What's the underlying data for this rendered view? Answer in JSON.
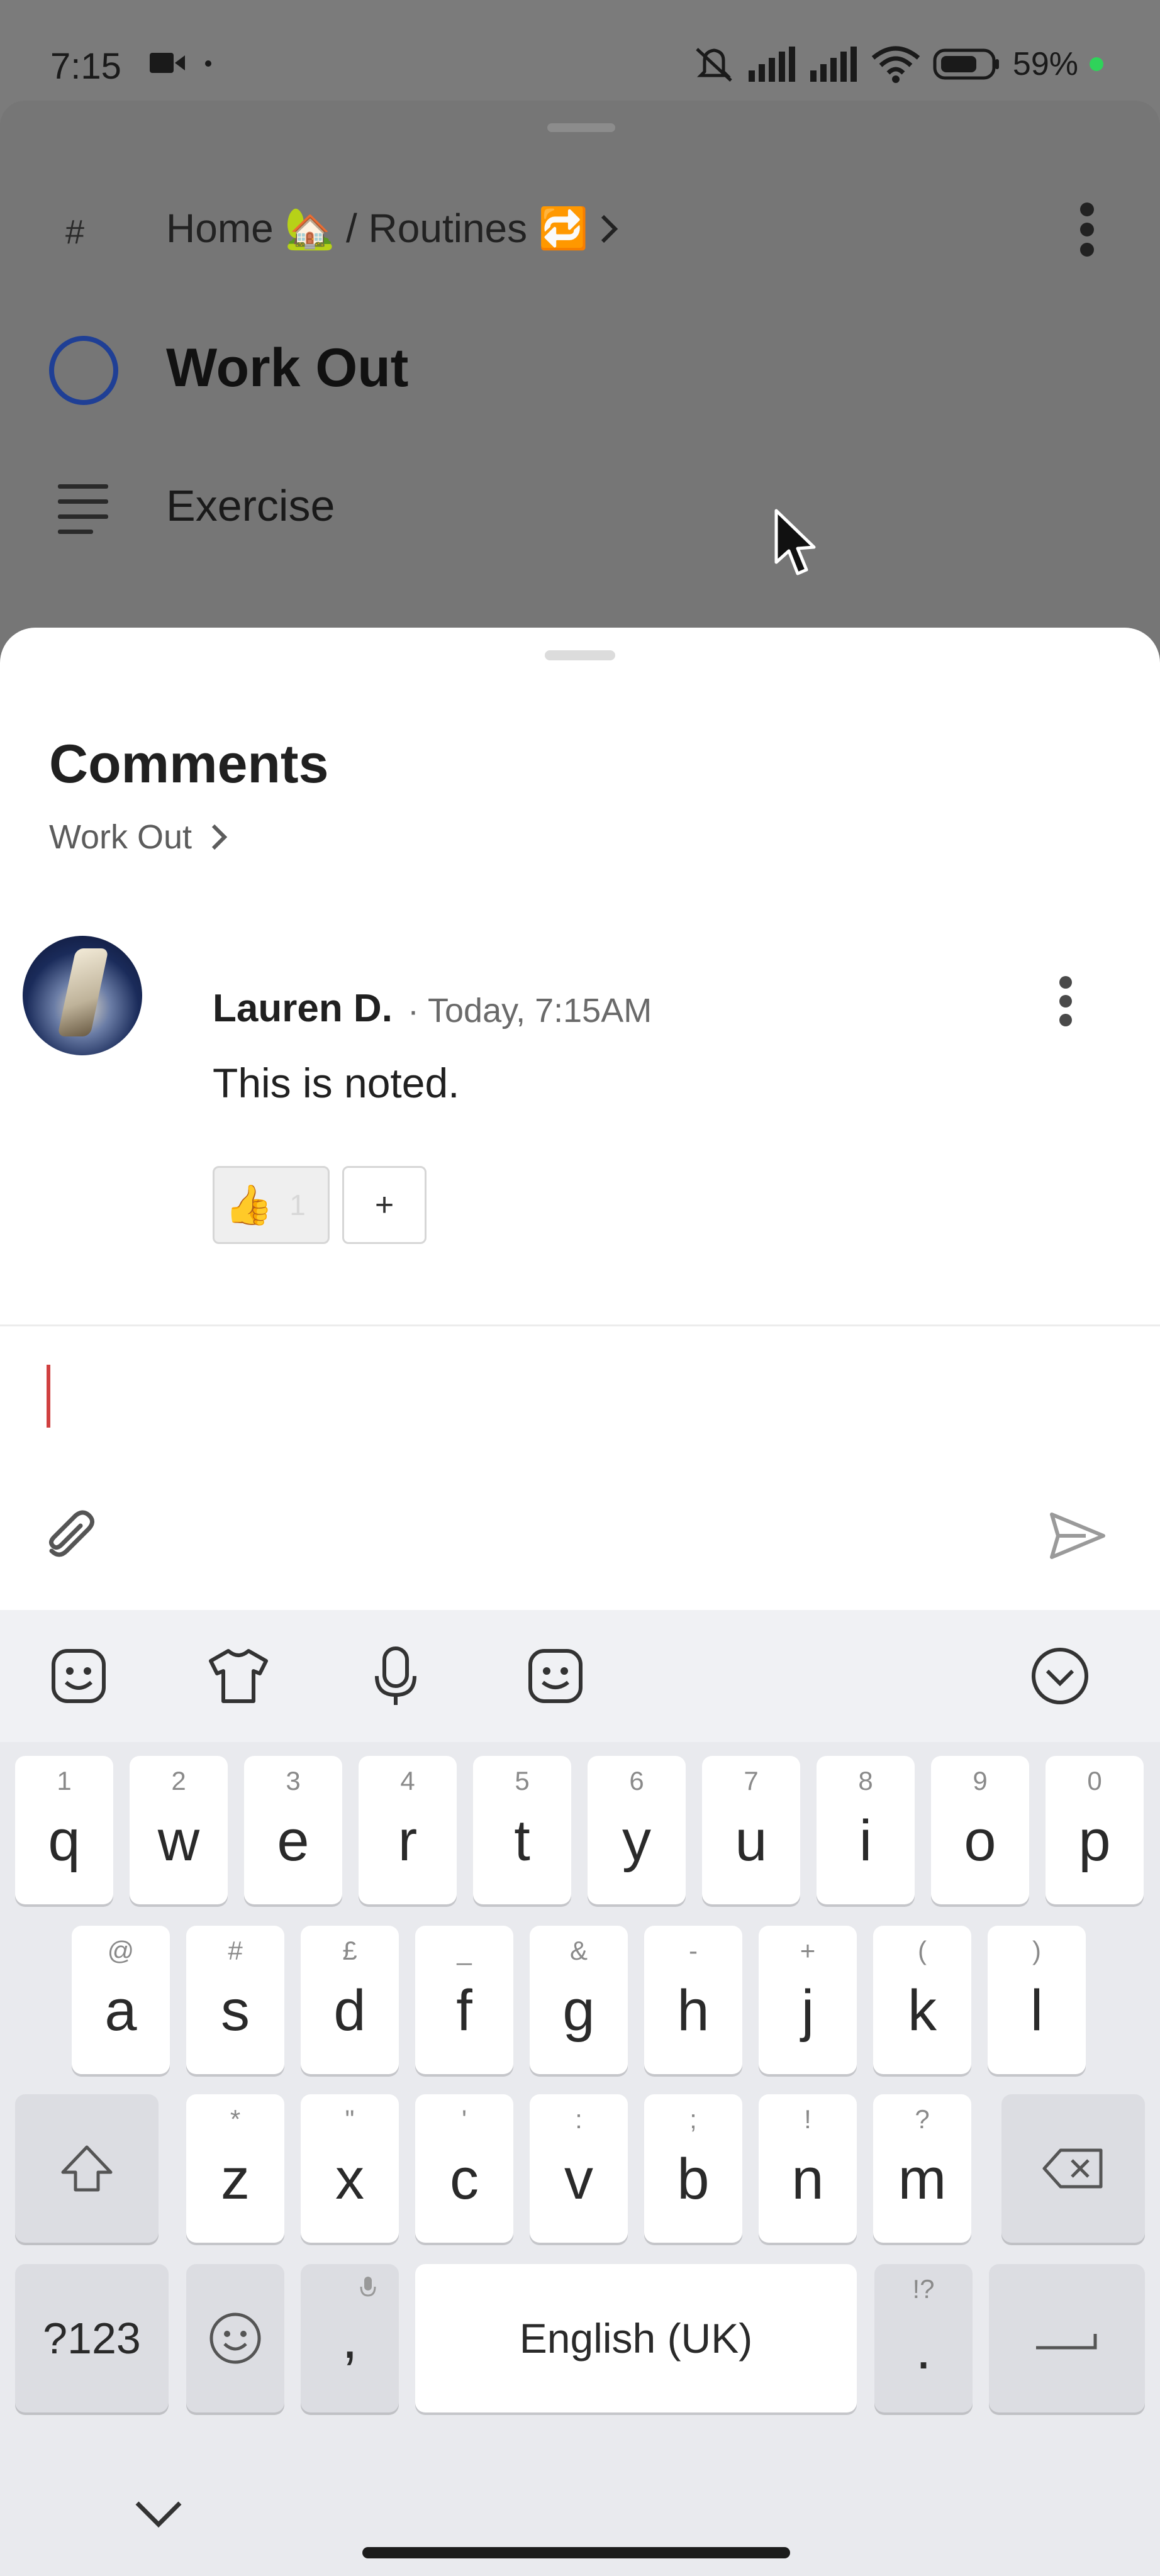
{
  "status_bar": {
    "time": "7:15",
    "battery": "59%",
    "icons": [
      "video-camera-icon",
      "mute-icon",
      "signal-icon",
      "signal-icon",
      "wifi-icon",
      "battery-icon"
    ]
  },
  "background_task": {
    "hash": "#",
    "breadcrumb": "Home 🏡 / Routines 🔁",
    "title": "Work Out",
    "description": "Exercise"
  },
  "comments_sheet": {
    "title": "Comments",
    "subtitle": "Work Out",
    "comments": [
      {
        "author": "Lauren D.",
        "timestamp": "· Today, 7:15AM",
        "text": "This is noted.",
        "reaction_emoji": "👍",
        "reaction_count": "1",
        "add_reaction": "+"
      }
    ],
    "input_value": "",
    "accent_color": "#d04040"
  },
  "keyboard": {
    "row1": [
      {
        "key": "q",
        "hint": "1"
      },
      {
        "key": "w",
        "hint": "2"
      },
      {
        "key": "e",
        "hint": "3"
      },
      {
        "key": "r",
        "hint": "4"
      },
      {
        "key": "t",
        "hint": "5"
      },
      {
        "key": "y",
        "hint": "6"
      },
      {
        "key": "u",
        "hint": "7"
      },
      {
        "key": "i",
        "hint": "8"
      },
      {
        "key": "o",
        "hint": "9"
      },
      {
        "key": "p",
        "hint": "0"
      }
    ],
    "row2": [
      {
        "key": "a",
        "hint": "@"
      },
      {
        "key": "s",
        "hint": "#"
      },
      {
        "key": "d",
        "hint": "£"
      },
      {
        "key": "f",
        "hint": "_"
      },
      {
        "key": "g",
        "hint": "&"
      },
      {
        "key": "h",
        "hint": "-"
      },
      {
        "key": "j",
        "hint": "+"
      },
      {
        "key": "k",
        "hint": "("
      },
      {
        "key": "l",
        "hint": ")"
      }
    ],
    "row3": [
      {
        "key": "z",
        "hint": "*"
      },
      {
        "key": "x",
        "hint": "\""
      },
      {
        "key": "c",
        "hint": "'"
      },
      {
        "key": "v",
        "hint": ":"
      },
      {
        "key": "b",
        "hint": ";"
      },
      {
        "key": "n",
        "hint": "!"
      },
      {
        "key": "m",
        "hint": "?"
      }
    ],
    "symbols_key": "?123",
    "comma_key": ",",
    "space_label": "English (UK)",
    "period_key": ".",
    "period_hint": "!?"
  }
}
